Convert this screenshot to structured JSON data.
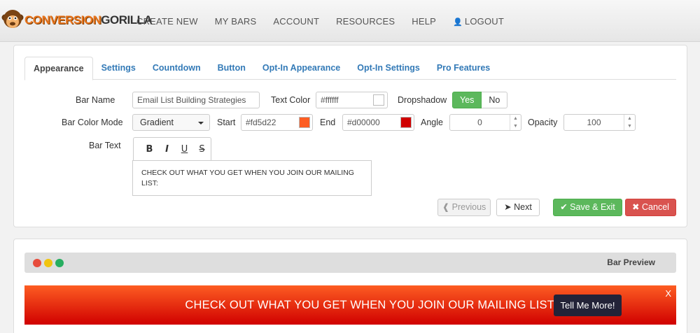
{
  "brand": {
    "part1": "CONVERSION",
    "part2": "GORILLA"
  },
  "nav": {
    "create_new": "CREATE NEW",
    "my_bars": "MY BARS",
    "account": "ACCOUNT",
    "resources": "RESOURCES",
    "help": "HELP",
    "logout": "LOGOUT"
  },
  "tabs": [
    "Appearance",
    "Settings",
    "Countdown",
    "Button",
    "Opt-In Appearance",
    "Opt-In Settings",
    "Pro Features"
  ],
  "form": {
    "bar_name_label": "Bar Name",
    "bar_name_value": "Email List Building Strategies",
    "text_color_label": "Text Color",
    "text_color_value": "#ffffff",
    "dropshadow_label": "Dropshadow",
    "dropshadow_yes": "Yes",
    "dropshadow_no": "No",
    "bar_color_mode_label": "Bar Color Mode",
    "bar_color_mode_value": "Gradient",
    "start_label": "Start",
    "start_value": "#fd5d22",
    "end_label": "End",
    "end_value": "#d00000",
    "angle_label": "Angle",
    "angle_value": "0",
    "opacity_label": "Opacity",
    "opacity_value": "100",
    "bar_text_label": "Bar Text",
    "toolbar": {
      "bold": "B",
      "italic": "I",
      "underline": "U",
      "strike": "S"
    },
    "bar_text_value": "CHECK OUT WHAT YOU GET WHEN YOU JOIN OUR MAILING LIST:"
  },
  "actions": {
    "previous": "Previous",
    "next": "Next",
    "save_exit": "Save & Exit",
    "cancel": "Cancel"
  },
  "preview": {
    "title": "Bar Preview",
    "bar_text": "CHECK OUT WHAT YOU GET WHEN YOU JOIN OUR MAILING LIST:",
    "bar_button": "Tell Me More!",
    "close": "X"
  },
  "colors": {
    "text": "#ffffff",
    "gradient_start": "#fd5d22",
    "gradient_end": "#d00000",
    "dot_red": "#e74c3c",
    "dot_yellow": "#f1c40f",
    "dot_green": "#27ae60",
    "button_bg": "#232338"
  },
  "icons": {
    "previous": "circle-chevron-left-icon",
    "next": "circle-chevron-right-icon",
    "save": "check-icon",
    "cancel": "x-icon",
    "logout": "user-icon"
  }
}
